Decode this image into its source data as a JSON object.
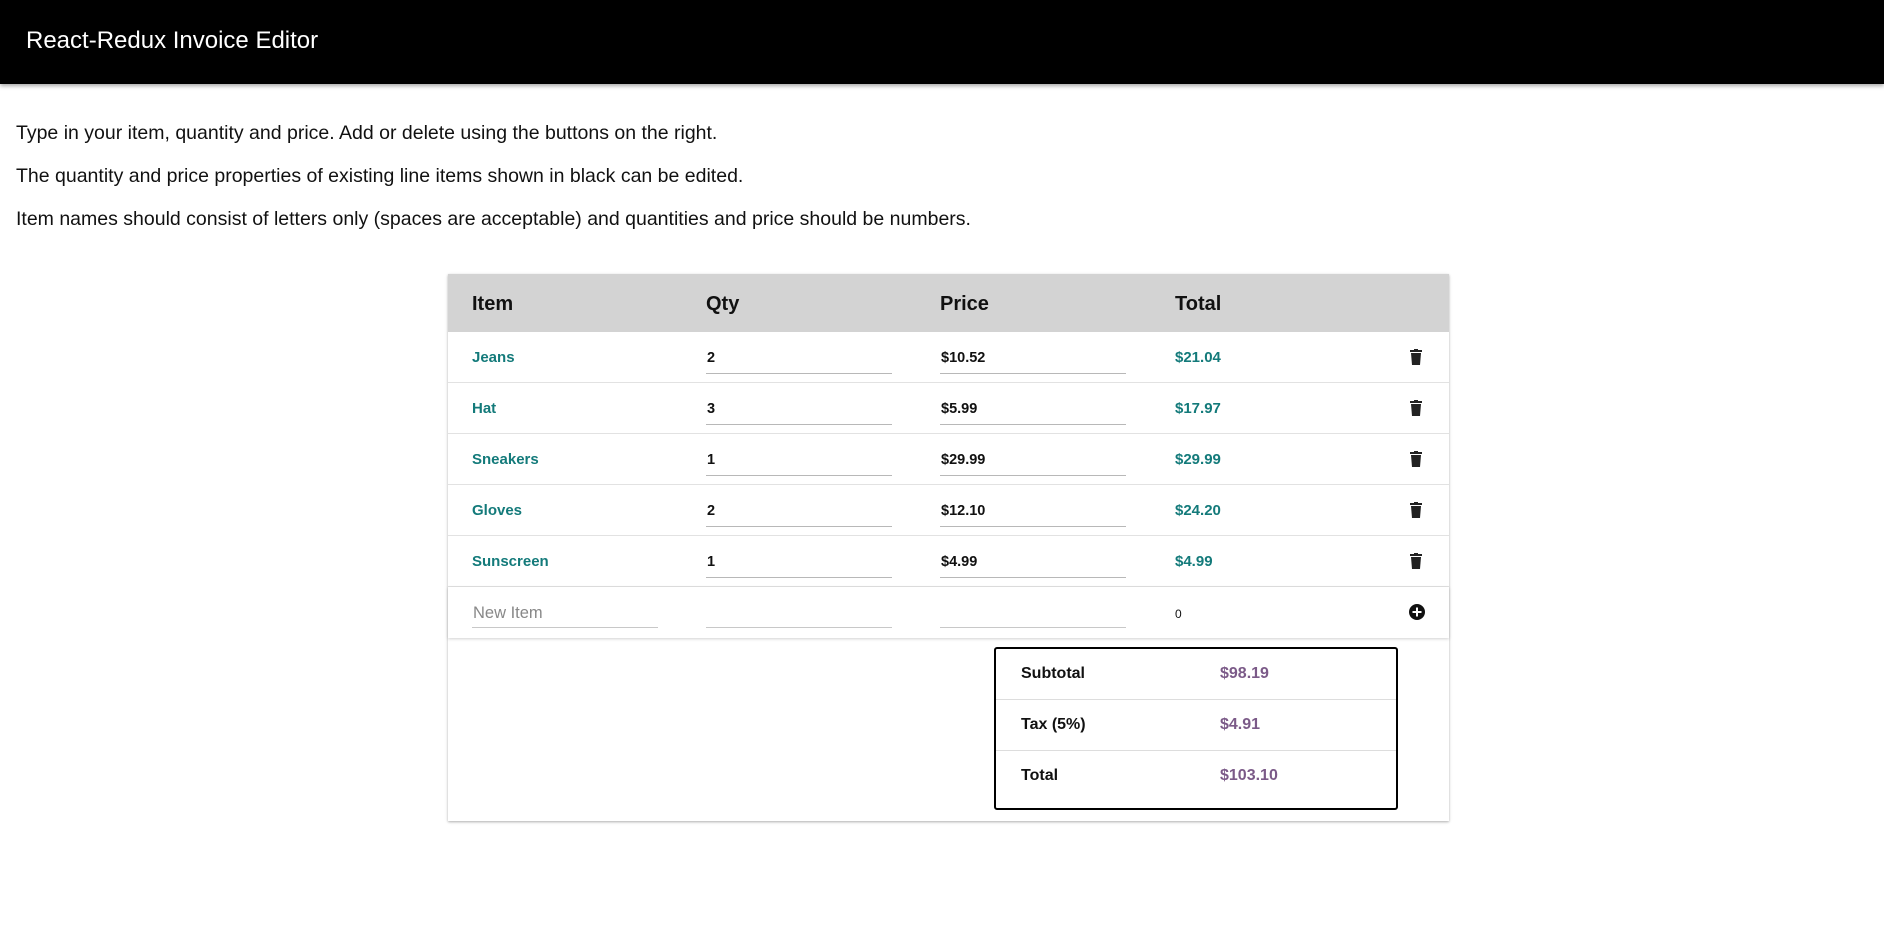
{
  "app": {
    "title": "React-Redux Invoice Editor"
  },
  "instructions": [
    "Type in your item, quantity and price. Add or delete using the buttons on the right.",
    "The quantity and price properties of existing line items shown in black can be edited.",
    "Item names should consist of letters only (spaces are acceptable) and quantities and price should be numbers."
  ],
  "table": {
    "headers": {
      "item": "Item",
      "qty": "Qty",
      "price": "Price",
      "total": "Total"
    },
    "rows": [
      {
        "item": "Jeans",
        "qty": "2",
        "price": "$10.52",
        "total": "$21.04"
      },
      {
        "item": "Hat",
        "qty": "3",
        "price": "$5.99",
        "total": "$17.97"
      },
      {
        "item": "Sneakers",
        "qty": "1",
        "price": "$29.99",
        "total": "$29.99"
      },
      {
        "item": "Gloves",
        "qty": "2",
        "price": "$12.10",
        "total": "$24.20"
      },
      {
        "item": "Sunscreen",
        "qty": "1",
        "price": "$4.99",
        "total": "$4.99"
      }
    ],
    "new_item": {
      "item_placeholder": "New Item",
      "qty": "",
      "price": "",
      "total": "0"
    },
    "row_action_icon": "trash-icon",
    "add_icon": "plus-circle-icon"
  },
  "summary": {
    "subtotal_label": "Subtotal",
    "subtotal_value": "$98.19",
    "tax_label": "Tax (5%)",
    "tax_value": "$4.91",
    "total_label": "Total",
    "total_value": "$103.10"
  },
  "colors": {
    "appbar": "#000000",
    "header_row": "#d3d3d3",
    "item_text": "#137a7a",
    "summary_value": "#7b5a88"
  }
}
